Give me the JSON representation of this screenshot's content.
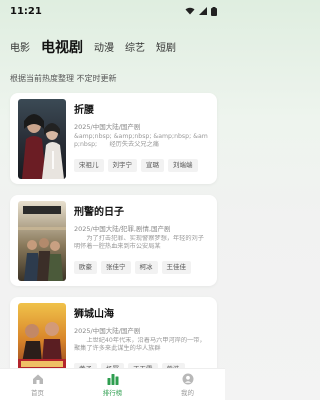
{
  "status_bar": {
    "time": "11:21"
  },
  "tabs": [
    {
      "label": "电影",
      "active": false
    },
    {
      "label": "电视剧",
      "active": true
    },
    {
      "label": "动漫",
      "active": false
    },
    {
      "label": "综艺",
      "active": false
    },
    {
      "label": "短剧",
      "active": false
    }
  ],
  "subtitle": "根据当前热度整理 不定时更新",
  "items": [
    {
      "title": "折腰",
      "meta": "2025/中国大陆/国产剧",
      "desc": "&amp;nbsp; &amp;nbsp; &amp;nbsp; &amp;nbsp;　　经历失去父兄之痛",
      "cast": [
        "宋祖儿",
        "刘宇宁",
        "宣璐",
        "刘端端"
      ]
    },
    {
      "title": "刑警的日子",
      "meta": "2025/中国大陆/犯罪,剧情,国产剧",
      "desc": "　　为了打击犯罪、实现警察梦想，年轻的刘子明怀着一腔热血来到市公安局某",
      "cast": [
        "欧豪",
        "张佳宁",
        "柯冰",
        "王佳佳"
      ]
    },
    {
      "title": "狮城山海",
      "meta": "2025/中国大陆/国产剧",
      "desc": "　　上世纪40年代末，沿着马六甲河岸的一带，聚集了许多来此谋生的华人族群",
      "cast": [
        "黄子",
        "杨幂",
        "王玉雯",
        "曾浩"
      ]
    }
  ],
  "bottom_nav": [
    {
      "label": "首页",
      "icon": "home-icon",
      "active": false
    },
    {
      "label": "排行榜",
      "icon": "ranking-icon",
      "active": true
    },
    {
      "label": "我的",
      "icon": "profile-icon",
      "active": false
    }
  ],
  "colors": {
    "accent": "#2e9e4f"
  }
}
